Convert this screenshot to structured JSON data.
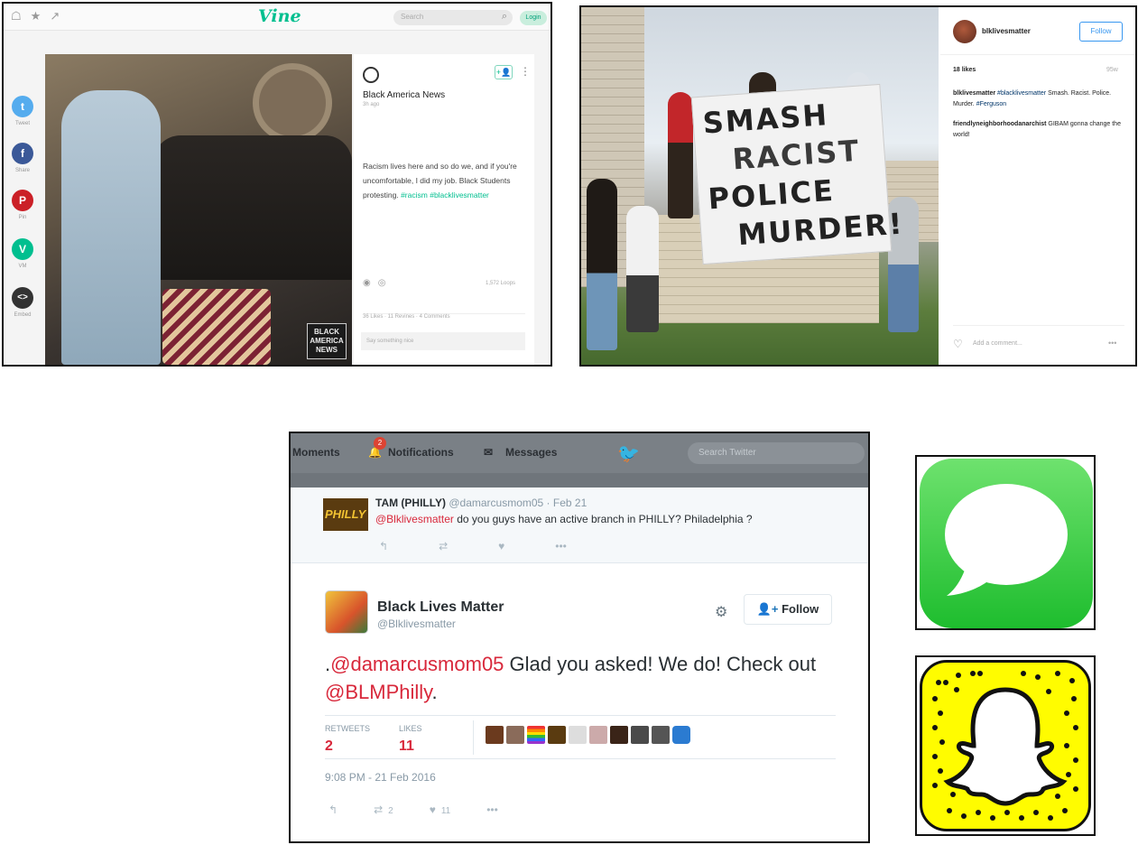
{
  "vine": {
    "logo": "Vine",
    "search_placeholder": "Search",
    "login": "Login",
    "share": [
      {
        "label": "Tweet",
        "icon": "twitter-icon",
        "color": "#55acee",
        "glyph": "t"
      },
      {
        "label": "Share",
        "icon": "facebook-icon",
        "color": "#3b5998",
        "glyph": "f"
      },
      {
        "label": "Pin",
        "icon": "pinterest-icon",
        "color": "#cb2027",
        "glyph": "P"
      },
      {
        "label": "VM",
        "icon": "vine-message-icon",
        "color": "#00bf8f",
        "glyph": "V"
      },
      {
        "label": "Embed",
        "icon": "embed-icon",
        "color": "#333333",
        "glyph": "<>"
      }
    ],
    "author": "Black America News",
    "ago": "3h ago",
    "caption": "Racism lives here and so do we, and if you're uncomfortable, I did my job. Black Students protesting.",
    "tags": [
      "#racism",
      "#blacklivesmatter"
    ],
    "loops": "1,572 Loops",
    "stats": "36 Likes · 11 Revines · 4 Comments",
    "comment_placeholder": "Say something nice",
    "watermark": "BLACK AMERICA NEWS"
  },
  "instagram": {
    "username": "blklivesmatter",
    "follow": "Follow",
    "likes": "18 likes",
    "age": "95w",
    "caption_user": "blklivesmatter",
    "caption_tag1": "#blacklivesmatter",
    "caption_text": "Smash. Racist. Police. Murder.",
    "caption_tag2": "#Ferguson",
    "comment_user": "friendlyneighborhoodanarchist",
    "comment_text": "GIBAM gonna change the world!",
    "add_comment": "Add a comment...",
    "banner_words": [
      "SMASH",
      "RACIST",
      "POLICE",
      "MURDER!"
    ]
  },
  "twitter": {
    "nav": {
      "moments": "Moments",
      "notifications": "Notifications",
      "notif_count": "2",
      "messages": "Messages",
      "search": "Search Twitter"
    },
    "reply": {
      "name": "TAM (PHILLY)",
      "handle": "@damarcusmom05 · Feb 21",
      "mention": "@Blklivesmatter",
      "text": " do you guys have an active branch in PHILLY? Philadelphia ?",
      "avatar_text": "PHILLY"
    },
    "main": {
      "name": "Black Lives Matter",
      "handle": "@Blklivesmatter",
      "follow": "Follow",
      "prefix": ".",
      "mention1": "@damarcusmom05",
      "text1": " Glad you asked! We do! Check out ",
      "mention2": "@BLMPhilly",
      "suffix": ".",
      "retweets_label": "RETWEETS",
      "retweets": "2",
      "likes_label": "LIKES",
      "likes": "11",
      "timestamp": "9:08 PM - 21 Feb 2016",
      "action_retweets": "2",
      "action_likes": "11"
    }
  },
  "apps": {
    "imessage": "imessage-icon",
    "snapchat": "snapchat-icon"
  }
}
